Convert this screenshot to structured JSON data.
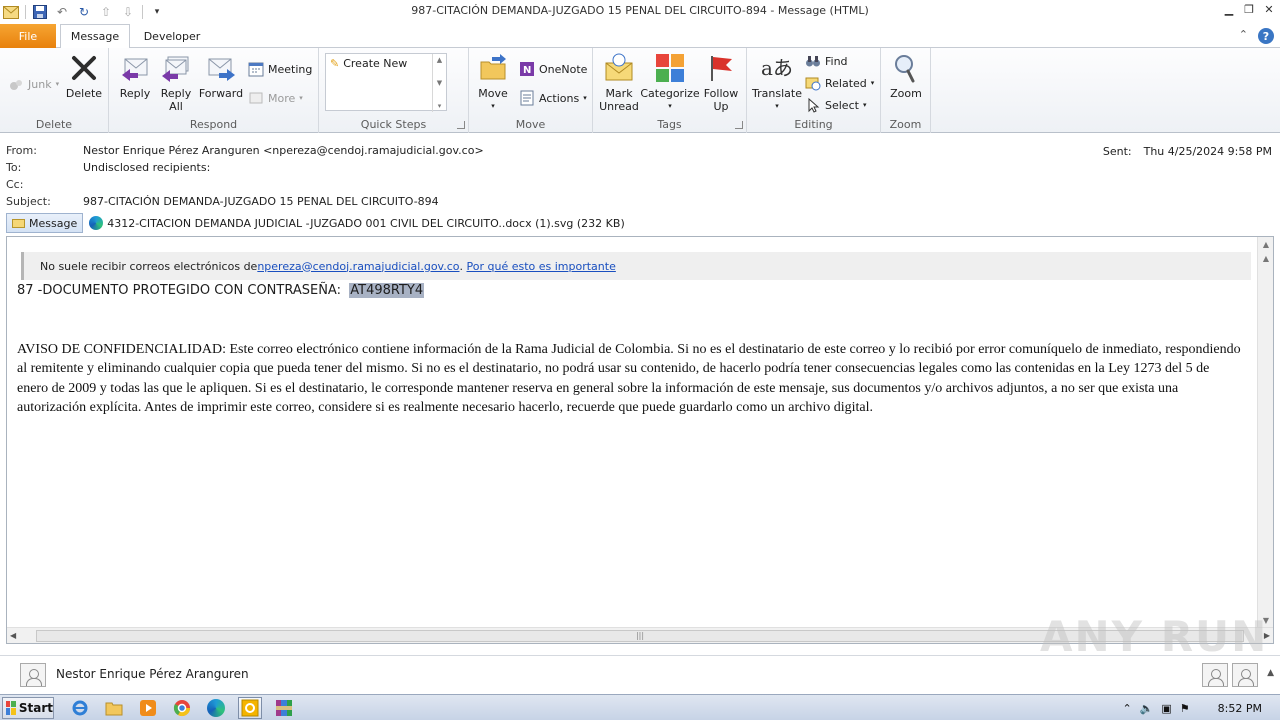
{
  "window": {
    "title": "987-CITACIÓN  DEMANDA-JUZGADO 15 PENAL DEL CIRCUITO-894  -  Message (HTML)"
  },
  "tabs": [
    {
      "label": "File"
    },
    {
      "label": "Message"
    },
    {
      "label": "Developer"
    }
  ],
  "ribbon": {
    "delete_group": {
      "label": "Delete",
      "junk": "Junk",
      "delete": "Delete"
    },
    "respond_group": {
      "label": "Respond",
      "reply": "Reply",
      "reply_all_1": "Reply",
      "reply_all_2": "All",
      "forward": "Forward",
      "meeting": "Meeting",
      "more": "More"
    },
    "quick_steps_group": {
      "label": "Quick Steps",
      "create_new": "Create New"
    },
    "move_group": {
      "label": "Move",
      "move": "Move",
      "onenote": "OneNote",
      "actions": "Actions"
    },
    "tags_group": {
      "label": "Tags",
      "mark_unread_1": "Mark",
      "mark_unread_2": "Unread",
      "categorize": "Categorize",
      "follow_up_1": "Follow",
      "follow_up_2": "Up"
    },
    "editing_group": {
      "label": "Editing",
      "translate": "Translate",
      "find": "Find",
      "related": "Related",
      "select": "Select"
    },
    "zoom_group": {
      "label": "Zoom",
      "zoom": "Zoom"
    }
  },
  "header": {
    "from_label": "From:",
    "from_value": "Nestor Enrique Pérez Aranguren <npereza@cendoj.ramajudicial.gov.co>",
    "to_label": "To:",
    "to_value": "Undisclosed recipients:",
    "cc_label": "Cc:",
    "cc_value": "",
    "subject_label": "Subject:",
    "subject_value": "987-CITACIÓN  DEMANDA-JUZGADO 15 PENAL DEL CIRCUITO-894",
    "sent_label": "Sent:",
    "sent_value": "Thu 4/25/2024 9:58 PM"
  },
  "attachments": {
    "message_tab": "Message",
    "file": "4312-CITACION  DEMANDA JUDICIAL -JUZGADO 001 CIVIL DEL CIRCUITO..docx (1).svg (232 KB)"
  },
  "body": {
    "notice_prefix": "No suele recibir correos electrónicos de ",
    "notice_email": "npereza@cendoj.ramajudicial.gov.co",
    "notice_dot": ". ",
    "notice_link": "Por qué esto es importante",
    "doc_line": "87 -DOCUMENTO PROTEGIDO CON CONTRASEÑA:  ",
    "password": "AT498RTY4",
    "confidentiality": "AVISO DE CONFIDENCIALIDAD: Este correo electrónico contiene información de la Rama Judicial de Colombia. Si no es el destinatario de este correo y lo recibió por error comuníquelo de inmediato, respondiendo al remitente y eliminando cualquier copia que pueda tener del mismo. Si no es el destinatario, no podrá usar su contenido, de hacerlo podría tener consecuencias legales como las contenidas en la Ley 1273 del 5 de enero de 2009 y todas las que le apliquen. Si es el destinatario, le corresponde mantener reserva en general sobre la información de este mensaje, sus documentos y/o archivos adjuntos, a no ser que exista una autorización explícita. Antes de imprimir este correo, considere si es realmente necesario hacerlo, recuerde que puede guardarlo como un archivo digital."
  },
  "people_pane": {
    "name": "Nestor Enrique Pérez Aranguren"
  },
  "watermark": "ANY RUN",
  "taskbar": {
    "start": "Start",
    "clock": "8:52 PM"
  }
}
